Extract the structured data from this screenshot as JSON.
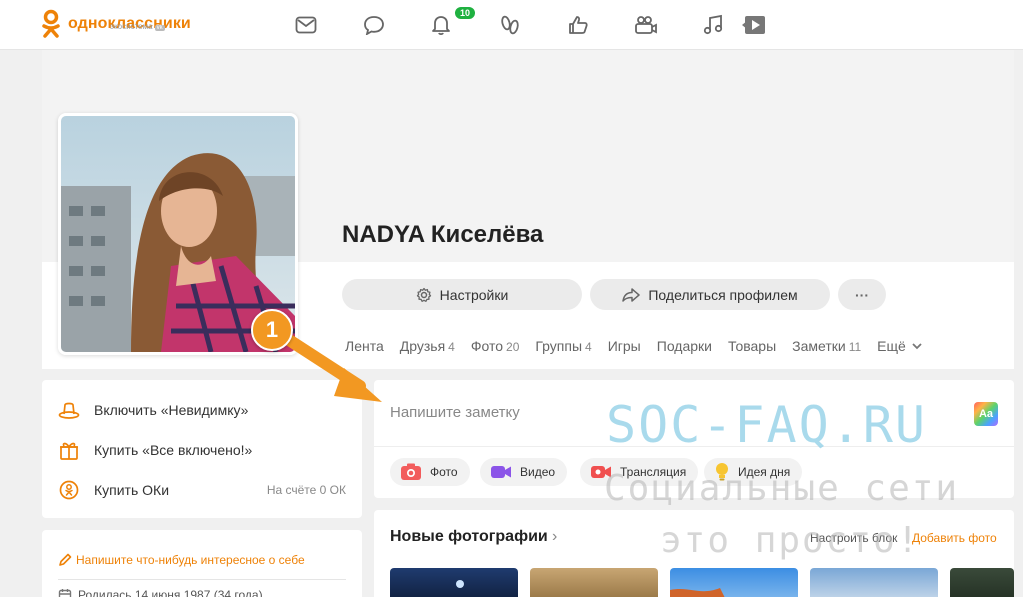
{
  "header": {
    "logo_text": "одноклассники",
    "logo_sub": "экосистема",
    "logo_sub_badge": "vk",
    "notifications_count": "10",
    "nav_icons": [
      "messages-icon",
      "discussions-icon",
      "notifications-icon",
      "guests-icon",
      "events-icon",
      "video-icon",
      "music-icon",
      "games-icon"
    ],
    "accent": "#ee8208"
  },
  "profile": {
    "name": "NADYA Киселёва",
    "settings_label": "Настройки",
    "share_label": "Поделиться профилем",
    "more_label": "···",
    "tabs": [
      {
        "label": "Лента",
        "count": ""
      },
      {
        "label": "Друзья",
        "count": "4"
      },
      {
        "label": "Фото",
        "count": "20"
      },
      {
        "label": "Группы",
        "count": "4"
      },
      {
        "label": "Игры",
        "count": ""
      },
      {
        "label": "Подарки",
        "count": ""
      },
      {
        "label": "Товары",
        "count": ""
      },
      {
        "label": "Заметки",
        "count": "11"
      },
      {
        "label": "Ещё",
        "count": ""
      }
    ]
  },
  "sidebar": {
    "items": [
      {
        "label": "Включить «Невидимку»",
        "right": ""
      },
      {
        "label": "Купить «Все включено!»",
        "right": ""
      },
      {
        "label": "Купить ОКи",
        "right": "На счёте 0 ОК"
      }
    ],
    "about_link": "Напишите что-нибудь интересное о себе",
    "birth": "Родилась 14 июня 1987 (34 года)"
  },
  "composer": {
    "placeholder": "Напишите заметку",
    "font_badge": "Aa",
    "chips": [
      "Фото",
      "Видео",
      "Трансляция",
      "Идея дня"
    ]
  },
  "photos": {
    "title": "Новые фотографии",
    "chevron": "›",
    "setup_label": "Настроить блок",
    "add_label": "Добавить фото"
  },
  "annotation": {
    "marker": "1",
    "watermark_1": "SOC-FAQ.RU",
    "watermark_2": "Социальные сети",
    "watermark_3": "это просто!"
  }
}
